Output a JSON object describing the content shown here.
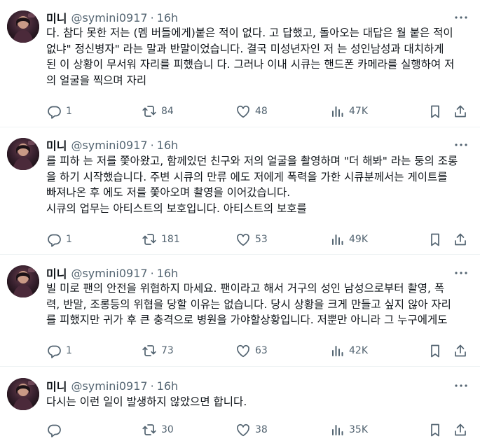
{
  "tweets": [
    {
      "name": "미니",
      "handle": "@symini0917",
      "separator": "·",
      "time": "16h",
      "lines": [
        "다. 참다 못한 저는 (멤 버들에게)붙은 적이 없다. 고 답했고, 돌아오는 대답은 월 붙은 적이",
        "없냐\" 정신병자\" 라는 말과 반말이었습니다. 결국  미성년자인 저 는 성인남성과 대치하게",
        "된 이 상황이 무서워 자리를 피했습니 다. 그러나 이내 시큐는 핸드폰 카메라를 실행하여 저",
        "의 얼굴을 찍으며 자리"
      ],
      "replies": "1",
      "reposts": "84",
      "likes": "48",
      "views": "47K"
    },
    {
      "name": "미니",
      "handle": "@symini0917",
      "separator": "·",
      "time": "16h",
      "lines": [
        "를 피하 는 저를 쫓아왔고, 함께있던 친구와 저의 얼굴을 촬영하며 \"더 해봐\" 라는 둥의 조롱",
        "을 하기 시작했습니다. 주변 시큐의 만류 에도 저에게 폭력을 가한 시큐분께서는 게이트를",
        "빠져나온 후 에도 저를 쫓아오며 촬영을 이어갔습니다.",
        "시큐의 업무는 아티스트의 보호입니다. 아티스트의 보호를"
      ],
      "replies": "1",
      "reposts": "181",
      "likes": "53",
      "views": "49K"
    },
    {
      "name": "미니",
      "handle": "@symini0917",
      "separator": "·",
      "time": "16h",
      "lines": [
        "빌 미로 팬의 안전을 위협하지 마세요. 팬이라고 해서 거구의 성인 남성으로부터 촬영, 폭",
        "력, 반말, 조롱등의 위협을 당할 이유는 없습니다. 당시 상황을 크게 만들고 싶지 않아 자리",
        "를 피했지만 귀가 후 큰 충격으로 병원을 가야할상황입니다. 저뿐만 아니라 그 누구에게도"
      ],
      "replies": "1",
      "reposts": "73",
      "likes": "63",
      "views": "42K"
    },
    {
      "name": "미니",
      "handle": "@symini0917",
      "separator": "·",
      "time": "16h",
      "lines": [
        "다시는 이런 일이 발생하지 않았으면 합니다."
      ],
      "replies": "",
      "reposts": "30",
      "likes": "38",
      "views": "35K"
    }
  ],
  "colors": {
    "text": "#0f1419",
    "secondary": "#536471",
    "divider": "#eff3f4"
  },
  "icons": [
    "reply-icon",
    "repost-icon",
    "like-icon",
    "views-icon",
    "bookmark-icon",
    "share-icon",
    "more-icon"
  ]
}
